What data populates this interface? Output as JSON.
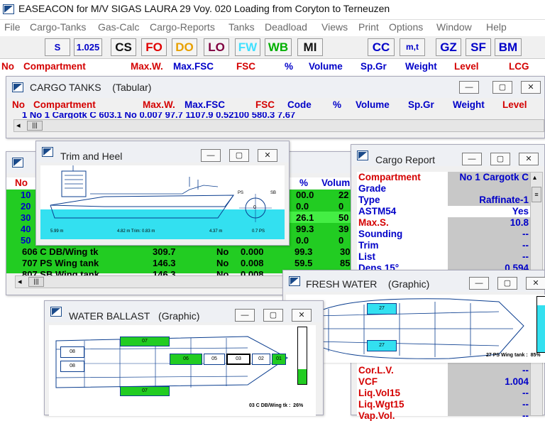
{
  "app_title": "EASEACON for M/V SIGAS LAURA 29  Voy. 020 Loading from Coryton to Terneuzen",
  "menu": [
    "File",
    "Cargo-Tanks",
    "Gas-Calc",
    "Cargo-Reports",
    "Tanks",
    "Deadload",
    "Views",
    "Print",
    "Options",
    "Window",
    "Help"
  ],
  "toolbar": {
    "s": "S",
    "v1025": "1.025",
    "cs": "CS",
    "fo": "FO",
    "do": "DO",
    "lo": "LO",
    "fw": "FW",
    "wb": "WB",
    "mi": "MI",
    "cc": "CC",
    "mt": "m,t",
    "gz": "GZ",
    "sf": "SF",
    "bm": "BM"
  },
  "colors": {
    "fo": "#e00000",
    "do": "#e8a000",
    "lo": "#800040",
    "fw": "#40e0ff",
    "wb": "#00b000",
    "mi": "#000000",
    "cc": "#0000c8",
    "green": "#22cc22",
    "cyan": "#33e0f0"
  },
  "main_header": {
    "no": "No",
    "compartment": "Compartment",
    "maxw": "Max.W.",
    "maxfsc": "Max.FSC",
    "fsc": "FSC",
    "pct": "%",
    "volume": "Volume",
    "spgr": "Sp.Gr",
    "weight": "Weight",
    "level": "Level",
    "lcg": "LCG"
  },
  "cargo_tanks": {
    "title": "CARGO TANKS",
    "mode": "(Tabular)",
    "h": {
      "no": "No",
      "compartment": "Compartment",
      "maxw": "Max.W.",
      "maxfsc": "Max.FSC",
      "fsc": "FSC",
      "code": "Code",
      "pct": "%",
      "volume": "Volume",
      "spgr": "Sp.Gr",
      "weight": "Weight",
      "level": "Level"
    },
    "row": "1 No 1 Cargotk C   603.1   No   0.007   97.7 1107.9   0.52100   580.3   7.67"
  },
  "trim": {
    "title": "Trim and Heel",
    "l1": "5.99 m",
    "l2": "4.82 m  Trim: 0.83 m",
    "l3": "4.37 m",
    "l4": "0.7 PS",
    "ps": "PS",
    "sb": "SB",
    "zero": "0"
  },
  "ballast_table": {
    "hdr_pct": "%",
    "hdr_vol": "Volum",
    "nos": [
      "10",
      "20",
      "30",
      "40",
      "50"
    ],
    "pcts": [
      "00.0",
      "0.0",
      "26.1",
      "99.3",
      "0.0"
    ],
    "vols": [
      "22",
      "0",
      "50",
      "39",
      "0"
    ],
    "rows": [
      {
        "c": "606 C DB/Wing tk",
        "w": "309.7",
        "m": "No",
        "f": "0.000",
        "p": "99.3",
        "v": "300"
      },
      {
        "c": "707 PS Wing tank",
        "w": "146.3",
        "m": "No",
        "f": "0.008",
        "p": "59.5",
        "v": "85"
      },
      {
        "c": "807 SB Wing tank",
        "w": "146.3",
        "m": "No",
        "f": "0.008",
        "p": "",
        "v": ""
      }
    ]
  },
  "report": {
    "title": "Cargo Report",
    "rows": [
      {
        "k": "Compartment",
        "v": "No 1 Cargotk C",
        "kc": "red"
      },
      {
        "k": "Grade",
        "v": "",
        "kc": "blue"
      },
      {
        "k": "Type",
        "v": "Raffinate-1",
        "kc": "blue"
      },
      {
        "k": "ASTM54",
        "v": "Yes",
        "kc": "blue"
      },
      {
        "k": "Max.S.",
        "v": "10.8",
        "kc": "red"
      },
      {
        "k": "Sounding",
        "v": "--",
        "kc": "blue"
      },
      {
        "k": "Trim",
        "v": "--",
        "kc": "blue"
      },
      {
        "k": "List",
        "v": "--",
        "kc": "blue"
      },
      {
        "k": "Dens 15°",
        "v": "0.594",
        "kc": "blue"
      }
    ],
    "rows2": [
      {
        "k": "Cor.L.V.",
        "v": "--"
      },
      {
        "k": "VCF",
        "v": "1.004"
      },
      {
        "k": "Liq.Vol15",
        "v": "--"
      },
      {
        "k": "Liq.Wgt15",
        "v": "--"
      },
      {
        "k": "Vap.Vol.",
        "v": "--"
      }
    ]
  },
  "fresh": {
    "title": "FRESH WATER",
    "mode": "(Graphic)",
    "t1": "27",
    "t2": "27",
    "label": "27 PS Wing tank :",
    "pct": "85%"
  },
  "ballast": {
    "title": "WATER BALLAST",
    "mode": "(Graphic)",
    "t08a": "08",
    "t08b": "08",
    "t07a": "07",
    "t07b": "07",
    "t06": "06",
    "t05": "05",
    "t03": "03",
    "t02": "02",
    "t01": "01",
    "label": "03 C DB/Wing tk :",
    "pct": "26%"
  },
  "bar_levels": {
    "fresh": 0.85,
    "ballast": 0.26
  }
}
